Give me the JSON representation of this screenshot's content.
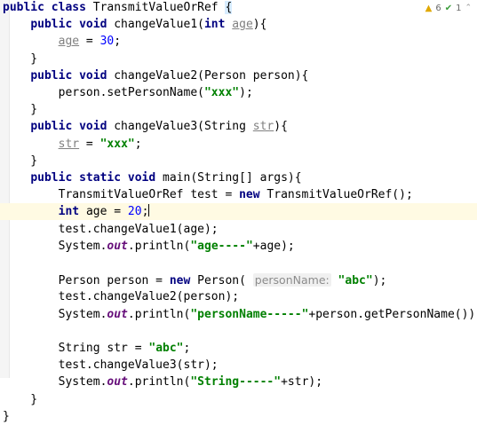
{
  "inspections": {
    "warnings": "6",
    "weak_warnings": "1"
  },
  "lines": [
    {
      "id": "l1",
      "tokens": [
        [
          "kw",
          "public class "
        ],
        [
          "plain",
          "TransmitValueOrRef "
        ],
        [
          "brace",
          "{"
        ]
      ]
    },
    {
      "id": "l2",
      "tokens": [
        [
          "plain",
          "    "
        ],
        [
          "kw",
          "public void "
        ],
        [
          "plain",
          "changeValue1("
        ],
        [
          "kw",
          "int "
        ],
        [
          "unused",
          "age"
        ],
        [
          "plain",
          "){"
        ]
      ]
    },
    {
      "id": "l3",
      "tokens": [
        [
          "plain",
          "        "
        ],
        [
          "unused",
          "age"
        ],
        [
          "plain",
          " = "
        ],
        [
          "num",
          "30"
        ],
        [
          "plain",
          ";"
        ]
      ]
    },
    {
      "id": "l4",
      "tokens": [
        [
          "plain",
          "    }"
        ]
      ]
    },
    {
      "id": "l5",
      "tokens": [
        [
          "plain",
          "    "
        ],
        [
          "kw",
          "public void "
        ],
        [
          "plain",
          "changeValue2(Person person){"
        ]
      ]
    },
    {
      "id": "l6",
      "tokens": [
        [
          "plain",
          "        person.setPersonName("
        ],
        [
          "str",
          "\"xxx\""
        ],
        [
          "plain",
          ");"
        ]
      ]
    },
    {
      "id": "l7",
      "tokens": [
        [
          "plain",
          "    }"
        ]
      ]
    },
    {
      "id": "l8",
      "tokens": [
        [
          "plain",
          "    "
        ],
        [
          "kw",
          "public void "
        ],
        [
          "plain",
          "changeValue3(String "
        ],
        [
          "unused",
          "str"
        ],
        [
          "plain",
          "){"
        ]
      ]
    },
    {
      "id": "l9",
      "tokens": [
        [
          "plain",
          "        "
        ],
        [
          "unused",
          "str"
        ],
        [
          "plain",
          " = "
        ],
        [
          "str",
          "\"xxx\""
        ],
        [
          "plain",
          ";"
        ]
      ]
    },
    {
      "id": "l10",
      "tokens": [
        [
          "plain",
          "    }"
        ]
      ]
    },
    {
      "id": "l11",
      "tokens": [
        [
          "plain",
          "    "
        ],
        [
          "kw",
          "public static void "
        ],
        [
          "plain",
          "main(String[] args){"
        ]
      ]
    },
    {
      "id": "l12",
      "tokens": [
        [
          "plain",
          "        TransmitValueOrRef test = "
        ],
        [
          "kw",
          "new "
        ],
        [
          "plain",
          "TransmitValueOrRef();"
        ]
      ]
    },
    {
      "id": "l13",
      "current": true,
      "tokens": [
        [
          "plain",
          "        "
        ],
        [
          "kw",
          "int "
        ],
        [
          "plain",
          "age = "
        ],
        [
          "num",
          "20"
        ],
        [
          "plain",
          ";"
        ],
        [
          "caret",
          ""
        ]
      ]
    },
    {
      "id": "l14",
      "tokens": [
        [
          "plain",
          "        test.changeValue1(age);"
        ]
      ]
    },
    {
      "id": "l15",
      "tokens": [
        [
          "plain",
          "        System."
        ],
        [
          "ital",
          "out"
        ],
        [
          "plain",
          ".println("
        ],
        [
          "str",
          "\"age----\""
        ],
        [
          "plain",
          "+age);"
        ]
      ]
    },
    {
      "id": "l16",
      "tokens": []
    },
    {
      "id": "l17",
      "tokens": [
        [
          "plain",
          "        Person person = "
        ],
        [
          "kw",
          "new "
        ],
        [
          "plain",
          "Person( "
        ],
        [
          "hint",
          "personName:"
        ],
        [
          "plain",
          " "
        ],
        [
          "str",
          "\"abc\""
        ],
        [
          "plain",
          ");"
        ]
      ]
    },
    {
      "id": "l18",
      "tokens": [
        [
          "plain",
          "        test.changeValue2(person);"
        ]
      ]
    },
    {
      "id": "l19",
      "tokens": [
        [
          "plain",
          "        System."
        ],
        [
          "ital",
          "out"
        ],
        [
          "plain",
          ".println("
        ],
        [
          "str",
          "\"personName-----\""
        ],
        [
          "plain",
          "+person.getPersonName());"
        ]
      ]
    },
    {
      "id": "l20",
      "tokens": []
    },
    {
      "id": "l21",
      "tokens": [
        [
          "plain",
          "        String str = "
        ],
        [
          "str",
          "\"abc\""
        ],
        [
          "plain",
          ";"
        ]
      ]
    },
    {
      "id": "l22",
      "tokens": [
        [
          "plain",
          "        test.changeValue3(str);"
        ]
      ]
    },
    {
      "id": "l23",
      "tokens": [
        [
          "plain",
          "        System."
        ],
        [
          "ital",
          "out"
        ],
        [
          "plain",
          ".println("
        ],
        [
          "str",
          "\"String-----\""
        ],
        [
          "plain",
          "+str);"
        ]
      ]
    },
    {
      "id": "l24",
      "tokens": [
        [
          "plain",
          "    }"
        ]
      ]
    },
    {
      "id": "l25",
      "tokens": [
        [
          "plain",
          "}"
        ]
      ]
    }
  ]
}
